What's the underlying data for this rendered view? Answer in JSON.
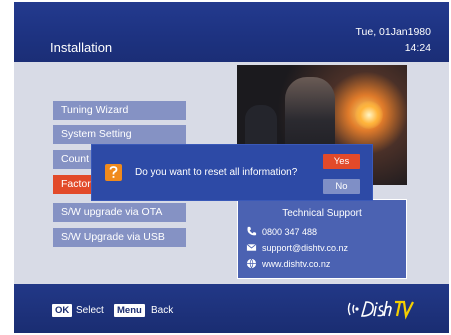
{
  "header": {
    "title": "Installation",
    "date": "Tue, 01Jan1980",
    "time": "14:24"
  },
  "menu": {
    "items": [
      {
        "label": "Tuning Wizard",
        "selected": false
      },
      {
        "label": "System Setting",
        "selected": false
      },
      {
        "label": "Count",
        "selected": false
      },
      {
        "label": "Factor",
        "selected": true
      },
      {
        "label": "S/W upgrade via OTA",
        "selected": false
      },
      {
        "label": "S/W Upgrade via USB",
        "selected": false
      }
    ]
  },
  "support": {
    "title": "Technical Support",
    "phone": "0800 347 488",
    "email": "support@dishtv.co.nz",
    "web": "www.dishtv.co.nz"
  },
  "dialog": {
    "message": "Do you want to reset all information?",
    "yes_label": "Yes",
    "no_label": "No"
  },
  "footer": {
    "ok_key": "OK",
    "ok_action": "Select",
    "menu_key": "Menu",
    "menu_action": "Back",
    "brand": "DishTV"
  },
  "colors": {
    "header_blue": "#1d3280",
    "menu_item": "#8592c4",
    "selected": "#e24a2a",
    "dialog": "#2d4aa6"
  }
}
